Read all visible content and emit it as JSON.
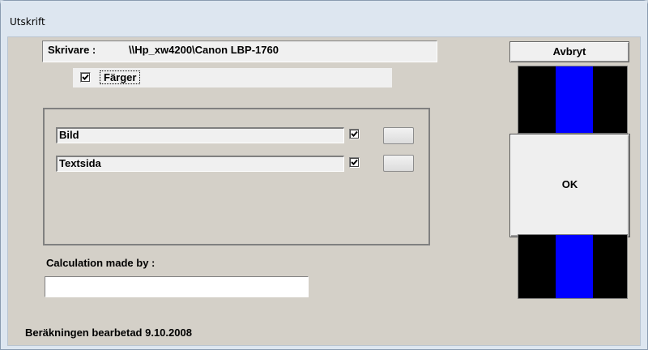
{
  "window": {
    "title": "Utskrift"
  },
  "printer": {
    "label": "Skrivare :",
    "path": "\\\\Hp_xw4200\\Canon LBP-1760"
  },
  "colors": {
    "label": "Färger",
    "checked": true
  },
  "print_items": [
    {
      "label": "Bild",
      "checked": true
    },
    {
      "label": "Textsida",
      "checked": true
    }
  ],
  "calculation": {
    "label": "Calculation made by :",
    "value": ""
  },
  "footer": {
    "date_text": "Beräkningen bearbetad  9.10.2008"
  },
  "buttons": {
    "cancel": "Avbryt",
    "ok": "OK"
  },
  "colors_theme": {
    "stripe_black": "#000000",
    "stripe_blue": "#0000ff"
  }
}
